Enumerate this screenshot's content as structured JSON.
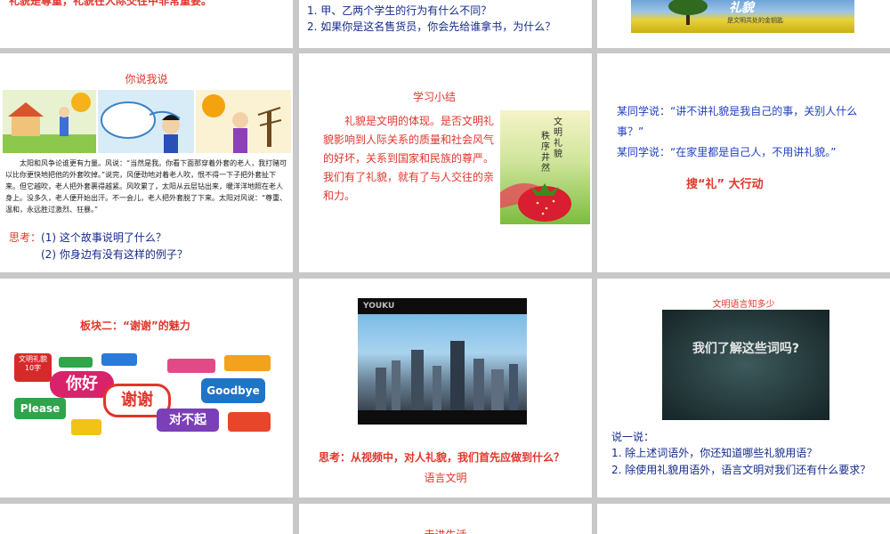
{
  "slides": {
    "s01": {
      "text": "礼貌是尊重，礼貌在人际交往中非常重要。"
    },
    "s02": {
      "q1": "1. 甲、乙两个学生的行为有什么不同？",
      "q2": "2. 如果你是这名售货员，你会先给谁拿书，为什么？"
    },
    "s03": {
      "logo": "礼貌",
      "caption": "是文明共处的金钥匙"
    },
    "s04": {
      "title": "你说我说",
      "story": "太阳和风争论谁更有力量。风说：“当然是我。你看下面那穿着外套的老人，我打赌可以比你更快地把他的外套吹掉。”说完，风便劲地对着老人吹，恨不得一下子把外套扯下来。但它越吹，老人把外套裹得越紧。风吹累了，太阳从云层钻出来，暖洋洋地照在老人身上。没多久，老人便开始出汗。不一会儿，老人把外套脱了下来。太阳对风说：“尊重、温和，永远胜过激烈、狂暴。”",
      "think_label": "思考：",
      "q1": "(1) 这个故事说明了什么？",
      "q2": "(2) 你身边有没有这样的例子？"
    },
    "s05": {
      "title": "学习小结",
      "text": "礼貌是文明的体现。是否文明礼貌影响到人际关系的质量和社会风气的好坏，关系到国家和民族的尊严。我们有了礼貌，就有了与人交往的亲和力。",
      "poster_l1": "文明礼貌",
      "poster_l2": "秩序井然"
    },
    "s06": {
      "say1": "某同学说：“讲不讲礼貌是我自己的事，关别人什么事？”",
      "say2": "某同学说：“在家里都是自己人，不用讲礼貌。”",
      "action": "搜“礼” 大行动"
    },
    "s07": {
      "title": "板块二：“谢谢”的魅力",
      "badge": "文明礼貌10字",
      "b_nihao": "你好",
      "b_please": "Please",
      "b_xiexie": "谢谢",
      "b_goodbye": "Goodbye",
      "b_duibuqi": "对不起"
    },
    "s08": {
      "video_logo": "YOUKU",
      "think": "思考：从视频中，对人礼貌，我们首先应做到什么？",
      "answer": "语言文明"
    },
    "s09": {
      "title": "文明语言知多少",
      "screen": "我们了解这些词吗?",
      "say": "说一说：",
      "q1": "1. 除上述词语外，你还知道哪些礼貌用语？",
      "q2": "2. 除使用礼貌用语外，语言文明对我们还有什么要求？"
    },
    "s11": {
      "title": "走进生活"
    }
  }
}
